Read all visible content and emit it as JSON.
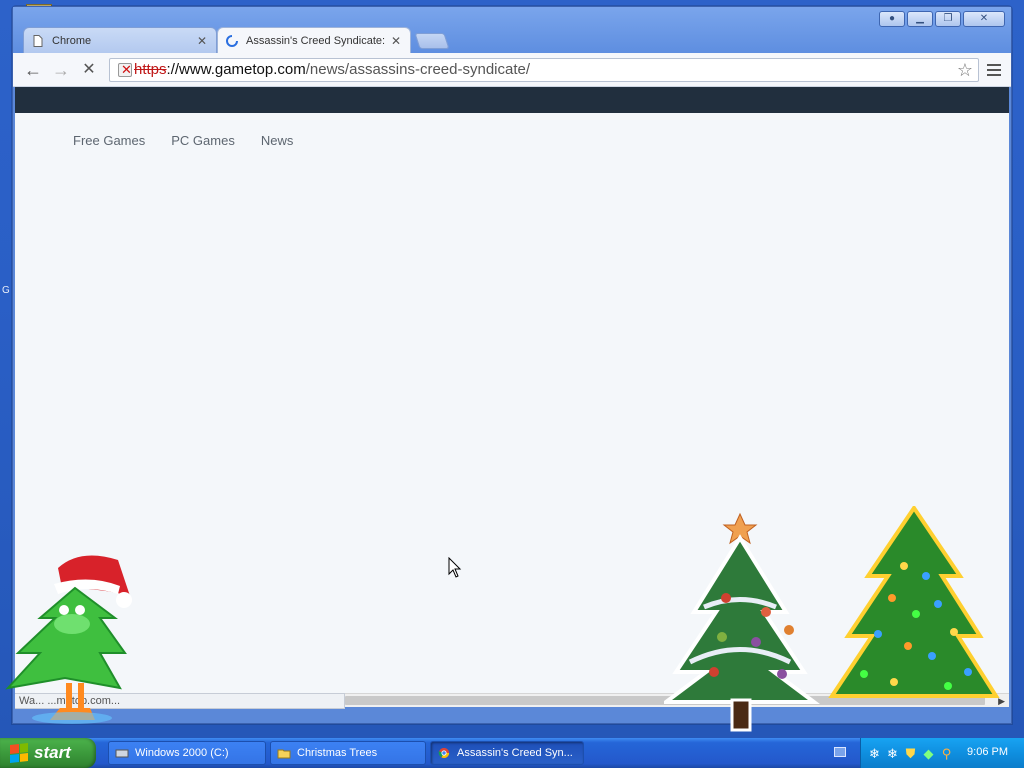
{
  "desktop": {
    "edge_letter": "G"
  },
  "browser": {
    "tabs": [
      {
        "label": "Chrome",
        "icon": "page-icon"
      },
      {
        "label": "Assassin's Creed Syndicate:",
        "icon": "loading-spinner-icon"
      }
    ],
    "window_buttons": [
      "user",
      "minimize",
      "restore",
      "close"
    ],
    "address": {
      "scheme": "https",
      "host": "://www.gametop.com",
      "path": "/news/assassins-creed-syndicate/"
    },
    "status_text": "Wa...  ...metop.com..."
  },
  "site": {
    "nav": [
      "Free Games",
      "PC Games",
      "News"
    ],
    "header_color": "#212f3e"
  },
  "taskbar": {
    "start_label": "start",
    "tasks": [
      {
        "label": "Windows 2000 (C:)",
        "icon": "drive-icon"
      },
      {
        "label": "Christmas Trees",
        "icon": "folder-icon"
      },
      {
        "label": "Assassin's Creed Syn...",
        "icon": "chrome-icon"
      }
    ],
    "clock": "9:06 PM"
  }
}
